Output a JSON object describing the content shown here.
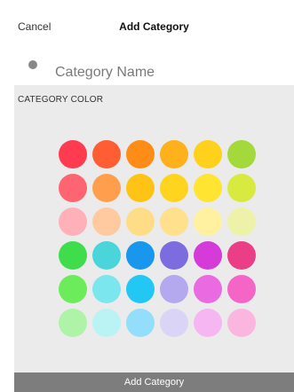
{
  "header": {
    "cancel_label": "Cancel",
    "title": "Add Category"
  },
  "name_field": {
    "placeholder": "Category Name",
    "value": ""
  },
  "color_section": {
    "label": "CATEGORY COLOR",
    "rows": [
      [
        "#ff3b4f",
        "#ff5e35",
        "#ff8c17",
        "#ffb11b",
        "#ffd01c",
        "#a3d93a"
      ],
      [
        "#ff6472",
        "#ff9e4c",
        "#ffc315",
        "#ffd41f",
        "#ffe431",
        "#d8ea3f"
      ],
      [
        "#ffb0b8",
        "#ffcaa0",
        "#ffdd86",
        "#ffe08d",
        "#fff1a0",
        "#eef2a8"
      ],
      [
        "#3fdd4b",
        "#49d5d9",
        "#1996ee",
        "#7b6ce0",
        "#d43bd8",
        "#ea3f86"
      ],
      [
        "#6cec5b",
        "#7be6ee",
        "#23c7f4",
        "#b4a8ee",
        "#ea6ae2",
        "#f565c6"
      ],
      [
        "#aff3a8",
        "#baf3f4",
        "#93defb",
        "#dad5f7",
        "#f5b6f2",
        "#fbb6df"
      ]
    ]
  },
  "footer": {
    "add_label": "Add Category"
  }
}
